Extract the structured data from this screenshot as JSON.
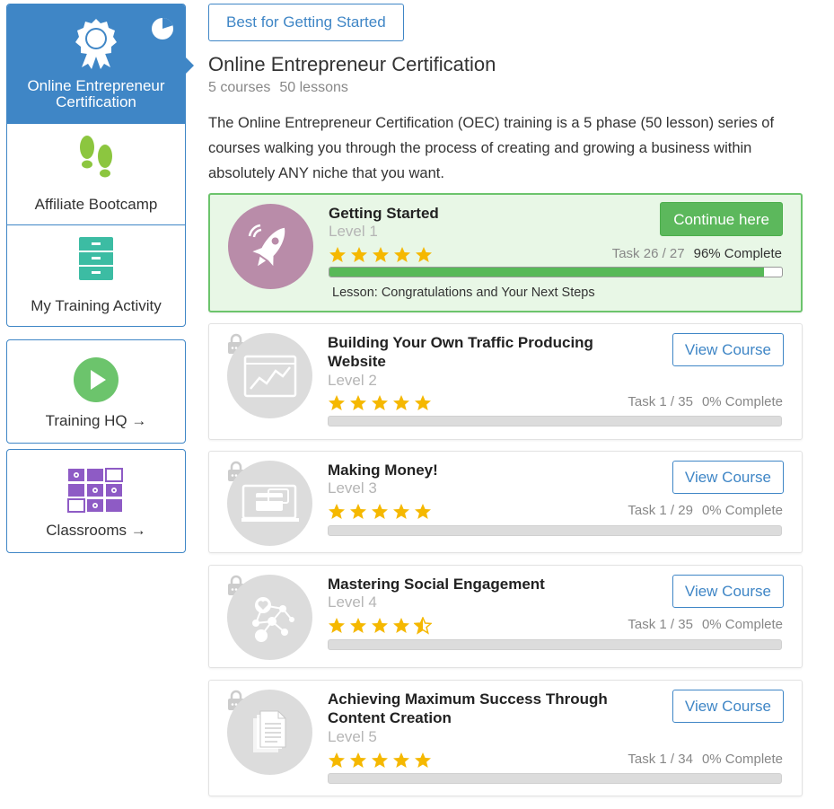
{
  "sidebar": {
    "items": [
      {
        "label": "Online Entrepreneur Certification",
        "icon": "award-ribbon-icon"
      },
      {
        "label": "Affiliate Bootcamp",
        "icon": "footprints-icon"
      },
      {
        "label": "My Training Activity",
        "icon": "filing-cabinet-icon"
      }
    ],
    "boxes": [
      {
        "label": "Training HQ →",
        "icon": "play-circle-icon"
      },
      {
        "label": "Classrooms →",
        "icon": "classroom-grid-icon"
      }
    ],
    "progress_fraction": 0.2
  },
  "main": {
    "badge": "Best for Getting Started",
    "title": "Online Entrepreneur Certification",
    "courses": "5 courses",
    "lessons": "50 lessons",
    "description": "The Online Entrepreneur Certification (OEC) training is a 5 phase (50 lesson) series of courses walking you through the process of creating and growing a business within absolutely ANY niche that you want."
  },
  "courses": [
    {
      "title": "Getting Started",
      "level": "Level 1",
      "task": "Task 26 / 27",
      "percent": "96% Complete",
      "progress": 0.96,
      "rating": 5,
      "button": "Continue here",
      "lesson": "Lesson: Congratulations and Your Next Steps",
      "icon": "rocket-icon"
    },
    {
      "title": "Building Your Own Traffic Producing Website",
      "level": "Level 2",
      "task": "Task 1 / 35",
      "percent": "0% Complete",
      "progress": 0,
      "rating": 5,
      "button": "View Course",
      "icon": "website-chart-icon"
    },
    {
      "title": "Making Money!",
      "level": "Level 3",
      "task": "Task 1 / 29",
      "percent": "0% Complete",
      "progress": 0,
      "rating": 5,
      "button": "View Course",
      "icon": "credit-card-icon"
    },
    {
      "title": "Mastering Social Engagement",
      "level": "Level 4",
      "task": "Task 1 / 35",
      "percent": "0% Complete",
      "progress": 0,
      "rating": 4.5,
      "button": "View Course",
      "icon": "social-network-icon"
    },
    {
      "title": "Achieving Maximum Success Through Content Creation",
      "level": "Level 5",
      "task": "Task 1 / 34",
      "percent": "0% Complete",
      "progress": 0,
      "rating": 5,
      "button": "View Course",
      "icon": "documents-icon"
    }
  ],
  "colors": {
    "accent": "#3f86c6",
    "success": "#5cb85c",
    "star": "#f5b800",
    "rocket_circle": "#b98ca9"
  }
}
